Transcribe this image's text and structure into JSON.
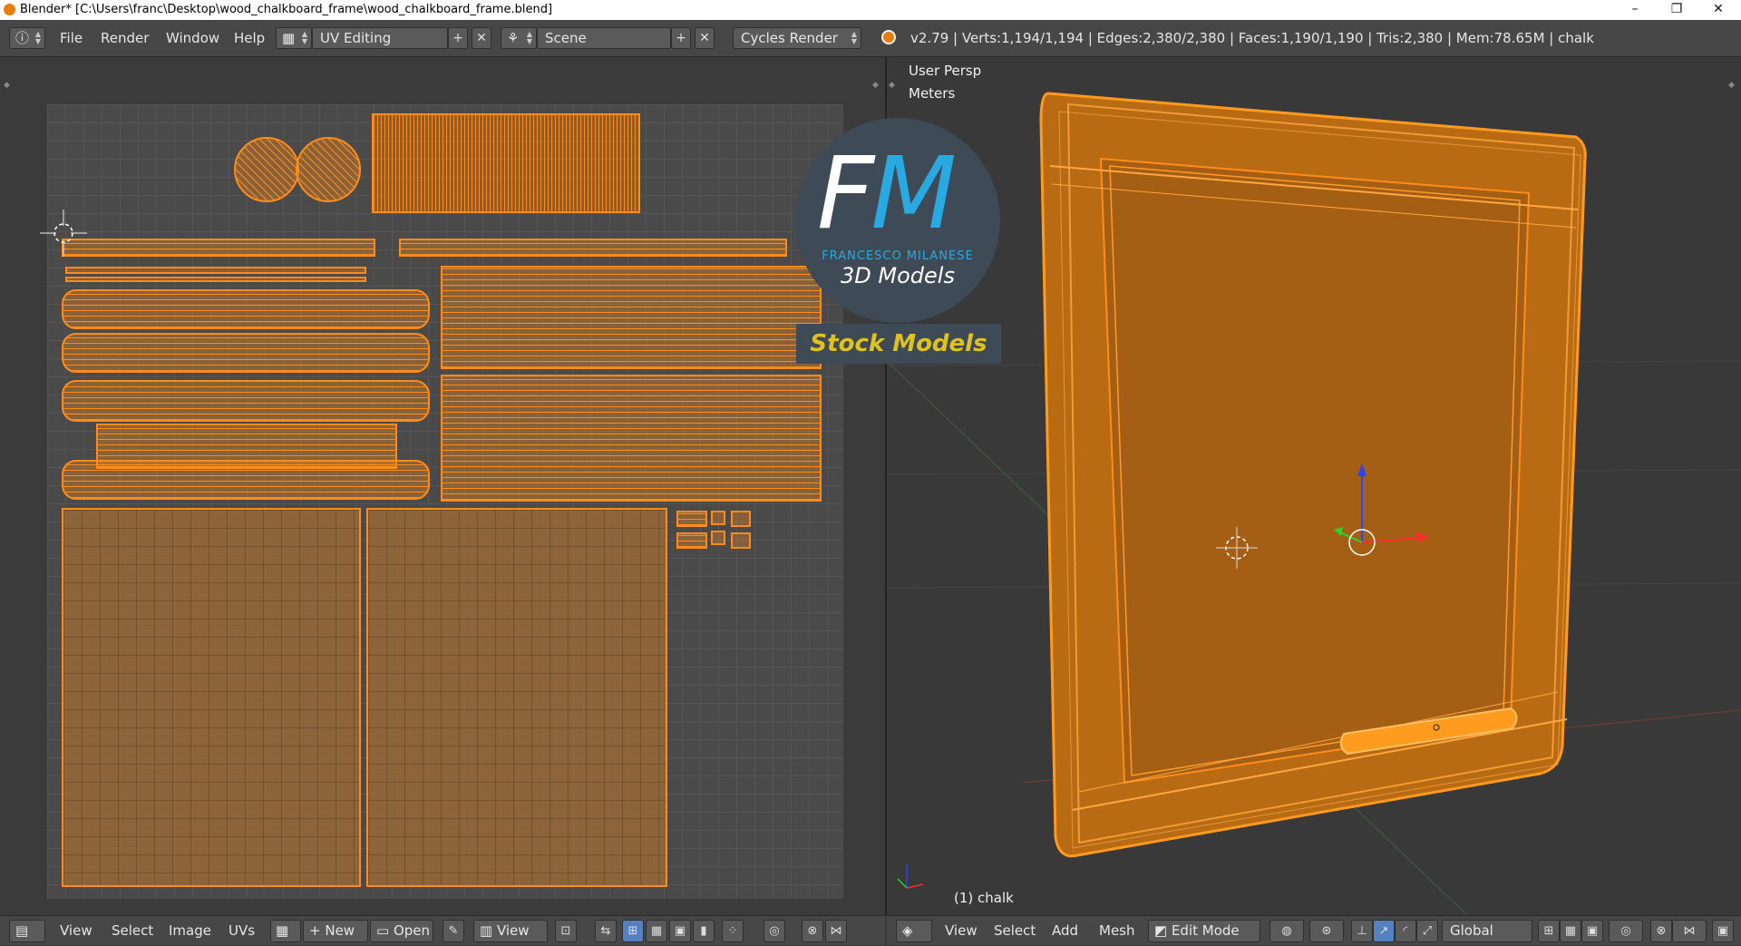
{
  "window": {
    "title": "Blender* [C:\\Users\\franc\\Desktop\\wood_chalkboard_frame\\wood_chalkboard_frame.blend]",
    "minimize": "–",
    "maximize": "❐",
    "close": "✕"
  },
  "infobar": {
    "menus": [
      "File",
      "Render",
      "Window",
      "Help"
    ],
    "screen_layout": "UV Editing",
    "scene": "Scene",
    "render_engine": "Cycles Render",
    "stats": "v2.79 | Verts:1,194/1,194 | Edges:2,380/2,380 | Faces:1,190/1,190 | Tris:2,380 | Mem:78.65M | chalk"
  },
  "viewport": {
    "view_name": "User Persp",
    "units": "Meters",
    "object_label": "(1) chalk"
  },
  "logo": {
    "letter_f": "F",
    "letter_m": "M",
    "brand": "FRANCESCO MILANESE",
    "subtitle": "3D Models",
    "banner": "Stock Models"
  },
  "uv_header": {
    "menus": [
      "View",
      "Select",
      "Image",
      "UVs"
    ],
    "new_label": "New",
    "open_label": "Open",
    "view_label": "View"
  },
  "view3d_header": {
    "menus": [
      "View",
      "Select",
      "Add",
      "Mesh"
    ],
    "mode": "Edit Mode",
    "orientation": "Global"
  },
  "colors": {
    "accent": "#ff8c1a",
    "panel": "#474747",
    "logo_blue": "#29a9e1",
    "logo_yellow": "#e0c21e"
  }
}
